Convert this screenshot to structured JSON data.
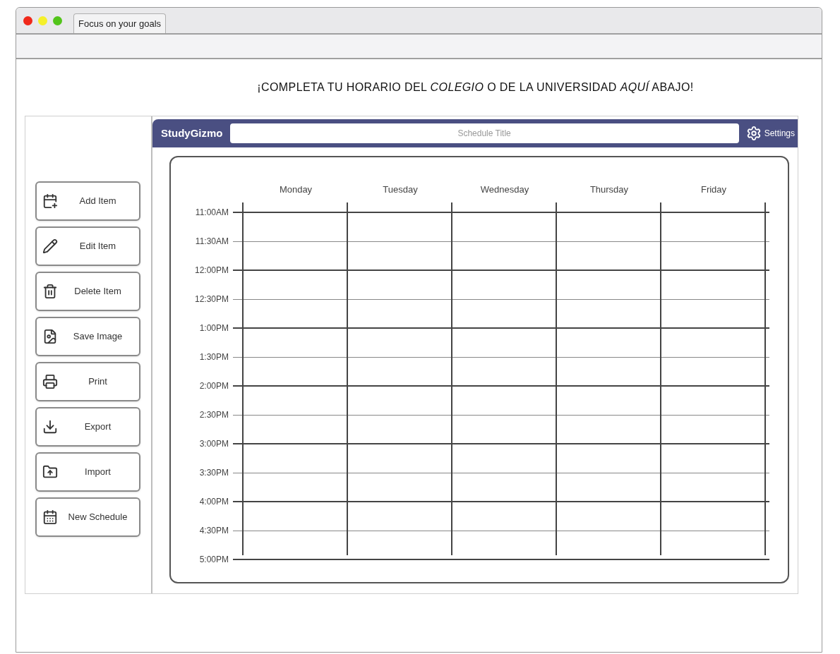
{
  "window": {
    "tab_title": "Focus on your goals"
  },
  "headline": "¡COMPLETA TU HORARIO DEL *COLEGIO* O DE LA UNIVERSIDAD *AQUÍ* ABAJO!",
  "app": {
    "brand": "StudyGizmo",
    "title_field": {
      "placeholder": "Schedule Title"
    },
    "settings": "Settings"
  },
  "actions": [
    {
      "label": "Add Item",
      "kind": "add"
    },
    {
      "label": "Edit Item",
      "kind": "edit"
    },
    {
      "label": "Delete Item",
      "kind": "delete"
    },
    {
      "label": "Save Image",
      "kind": "image"
    },
    {
      "label": "Print",
      "kind": "print"
    },
    {
      "label": "Export",
      "kind": "export"
    },
    {
      "label": "Import",
      "kind": "import"
    },
    {
      "label": "New Schedule",
      "kind": "calendar"
    }
  ],
  "schedule": {
    "days": [
      "Monday",
      "Tuesday",
      "Wednesday",
      "Thursday",
      "Friday"
    ],
    "times": [
      {
        "label": "11:00AM",
        "kind": "hour"
      },
      {
        "label": "11:30AM",
        "kind": "half"
      },
      {
        "label": "12:00PM",
        "kind": "hour"
      },
      {
        "label": "12:30PM",
        "kind": "half"
      },
      {
        "label": "1:00PM",
        "kind": "hour"
      },
      {
        "label": "1:30PM",
        "kind": "half"
      },
      {
        "label": "2:00PM",
        "kind": "hour"
      },
      {
        "label": "2:30PM",
        "kind": "half"
      },
      {
        "label": "3:00PM",
        "kind": "hour"
      },
      {
        "label": "3:30PM",
        "kind": "half"
      },
      {
        "label": "4:00PM",
        "kind": "hour"
      },
      {
        "label": "4:30PM",
        "kind": "half"
      },
      {
        "label": "5:00PM",
        "kind": "hour"
      }
    ]
  }
}
